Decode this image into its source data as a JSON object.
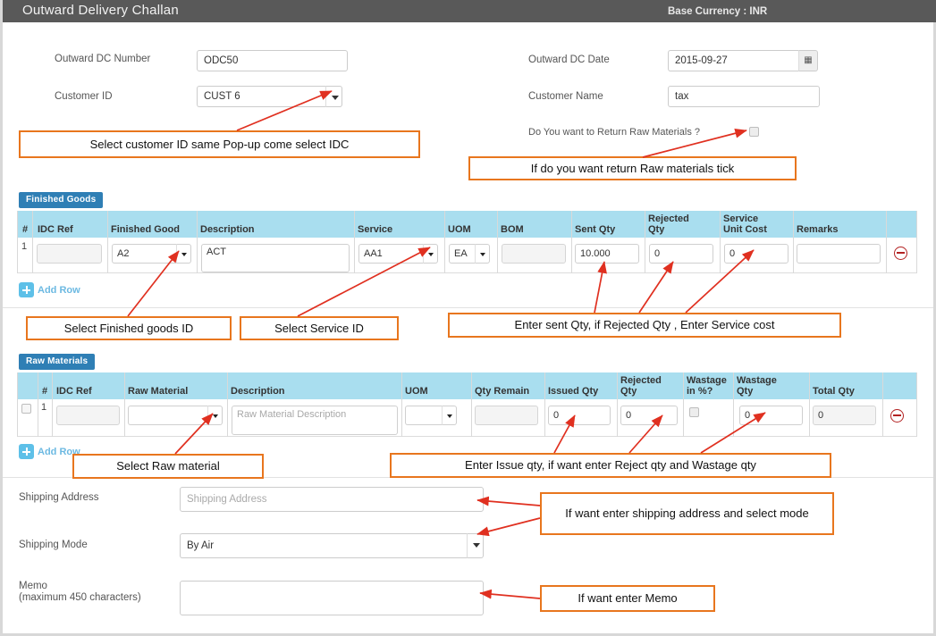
{
  "header": {
    "title": "Outward Delivery Challan",
    "currency_label": "Base Currency : INR"
  },
  "form": {
    "outward_dc_number_label": "Outward DC Number",
    "outward_dc_number_value": "ODC50",
    "customer_id_label": "Customer ID",
    "customer_id_value": "CUST 6",
    "outward_dc_date_label": "Outward DC Date",
    "outward_dc_date_value": "2015-09-27",
    "customer_name_label": "Customer Name",
    "customer_name_value": "tax",
    "return_raw_label": "Do You want to Return Raw Materials ?"
  },
  "finished_goods": {
    "badge": "Finished Goods",
    "columns": [
      "#",
      "IDC Ref",
      "Finished Good",
      "Description",
      "Service",
      "UOM",
      "BOM",
      "Sent Qty",
      "Rejected Qty",
      "Service Unit Cost",
      "Remarks"
    ],
    "rows": [
      {
        "num": "1",
        "idc_ref": "",
        "finished_good": "A2",
        "description": "ACT",
        "service": "AA1",
        "uom": "EA",
        "bom": "",
        "sent_qty": "10.000",
        "rejected_qty": "0",
        "service_unit_cost": "0",
        "remarks": ""
      }
    ],
    "add_row_label": "Add Row"
  },
  "raw_materials": {
    "badge": "Raw Materials",
    "columns": [
      "#",
      "IDC Ref",
      "Raw Material",
      "Description",
      "UOM",
      "Qty Remain",
      "Issued Qty",
      "Rejected Qty",
      "Wastage in %?",
      "Wastage Qty",
      "Total Qty"
    ],
    "rows": [
      {
        "num": "1",
        "idc_ref": "",
        "raw_material": "",
        "description_placeholder": "Raw Material Description",
        "uom": "",
        "qty_remain": "",
        "issued_qty": "0",
        "rejected_qty": "0",
        "wastage_qty": "0",
        "total_qty": "0"
      }
    ],
    "add_row_label": "Add Row"
  },
  "shipping": {
    "address_label": "Shipping Address",
    "address_placeholder": "Shipping Address",
    "mode_label": "Shipping Mode",
    "mode_value": "By Air",
    "memo_label": "Memo",
    "memo_sublabel": "(maximum 450 characters)",
    "memo_value": ""
  },
  "annotations": [
    {
      "id": "a1",
      "text": "Select customer ID  same Pop-up come select IDC"
    },
    {
      "id": "a2",
      "text": "If do you want return Raw materials tick"
    },
    {
      "id": "a3",
      "text": "Select Finished goods ID"
    },
    {
      "id": "a4",
      "text": "Select Service ID"
    },
    {
      "id": "a5",
      "text": "Enter sent Qty, if Rejected Qty , Enter Service cost"
    },
    {
      "id": "a6",
      "text": "Select Raw material"
    },
    {
      "id": "a7",
      "text": "Enter  Issue qty, if want enter Reject qty and Wastage qty"
    },
    {
      "id": "a8",
      "text": "If want enter shipping address and select mode"
    },
    {
      "id": "a9",
      "text": "If want enter Memo"
    }
  ],
  "colors": {
    "header_bar": "#595959",
    "grid_header": "#a9deef",
    "badge": "#2f7fb5",
    "callout_border": "#e8761e",
    "arrow": "#e03020",
    "add_row": "#6cb9e2"
  }
}
